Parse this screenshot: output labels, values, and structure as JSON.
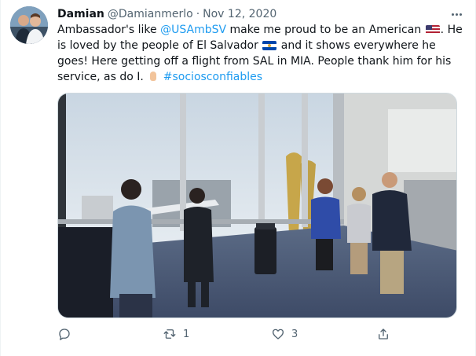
{
  "author": {
    "display_name": "Damian",
    "handle": "@Damianmerlo",
    "separator": "·",
    "date": "Nov 12, 2020"
  },
  "tweet": {
    "text_1": "Ambassador's like ",
    "mention": "@USAmbSV",
    "text_2": " make me proud to be an American ",
    "text_3": ". He is loved by the people of El Salvador ",
    "text_4": " and it shows everywhere he goes! Here getting off a flight from SAL in MIA. People thank him for his service, as do I. ",
    "hashtag": "#sociosconfiables"
  },
  "emojis": [
    "us-flag-emoji",
    "el-salvador-flag-emoji",
    "folded-hands-emoji"
  ],
  "actions": {
    "reply_count": "",
    "retweet_count": "1",
    "like_count": "3"
  },
  "colors": {
    "link": "#1d9bf0",
    "secondary_text": "#536471",
    "primary_text": "#0f1419"
  }
}
